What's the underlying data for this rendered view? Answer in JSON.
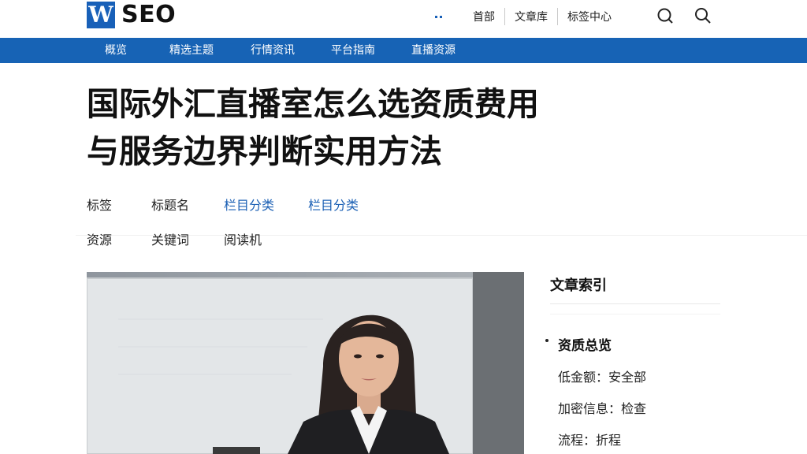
{
  "logo": {
    "mark": "W",
    "name": "SEO"
  },
  "top_links": [
    "首部",
    "文章库",
    "标签中心"
  ],
  "nav": [
    "概览",
    "精选主题",
    "行情资讯",
    "平台指南",
    "直播资源"
  ],
  "article": {
    "title_line1": "国际外汇直播室怎么选资质费用",
    "title_line2": "与服务边界判断实用方法"
  },
  "meta": {
    "row1": [
      "标签",
      "标题名",
      "栏目分类",
      "栏目分类"
    ],
    "row2": [
      "资源",
      "关键词",
      "阅读机"
    ]
  },
  "sidebar": {
    "title": "文章索引",
    "heading": "资质总览",
    "items": [
      "低金额：安全部",
      "加密信息：检查",
      "流程：折程"
    ]
  },
  "colors": {
    "brand": "#1763b5",
    "link": "#1a5fb4"
  },
  "icons": [
    "hamburger-dots-icon",
    "search-icon",
    "search-icon"
  ]
}
